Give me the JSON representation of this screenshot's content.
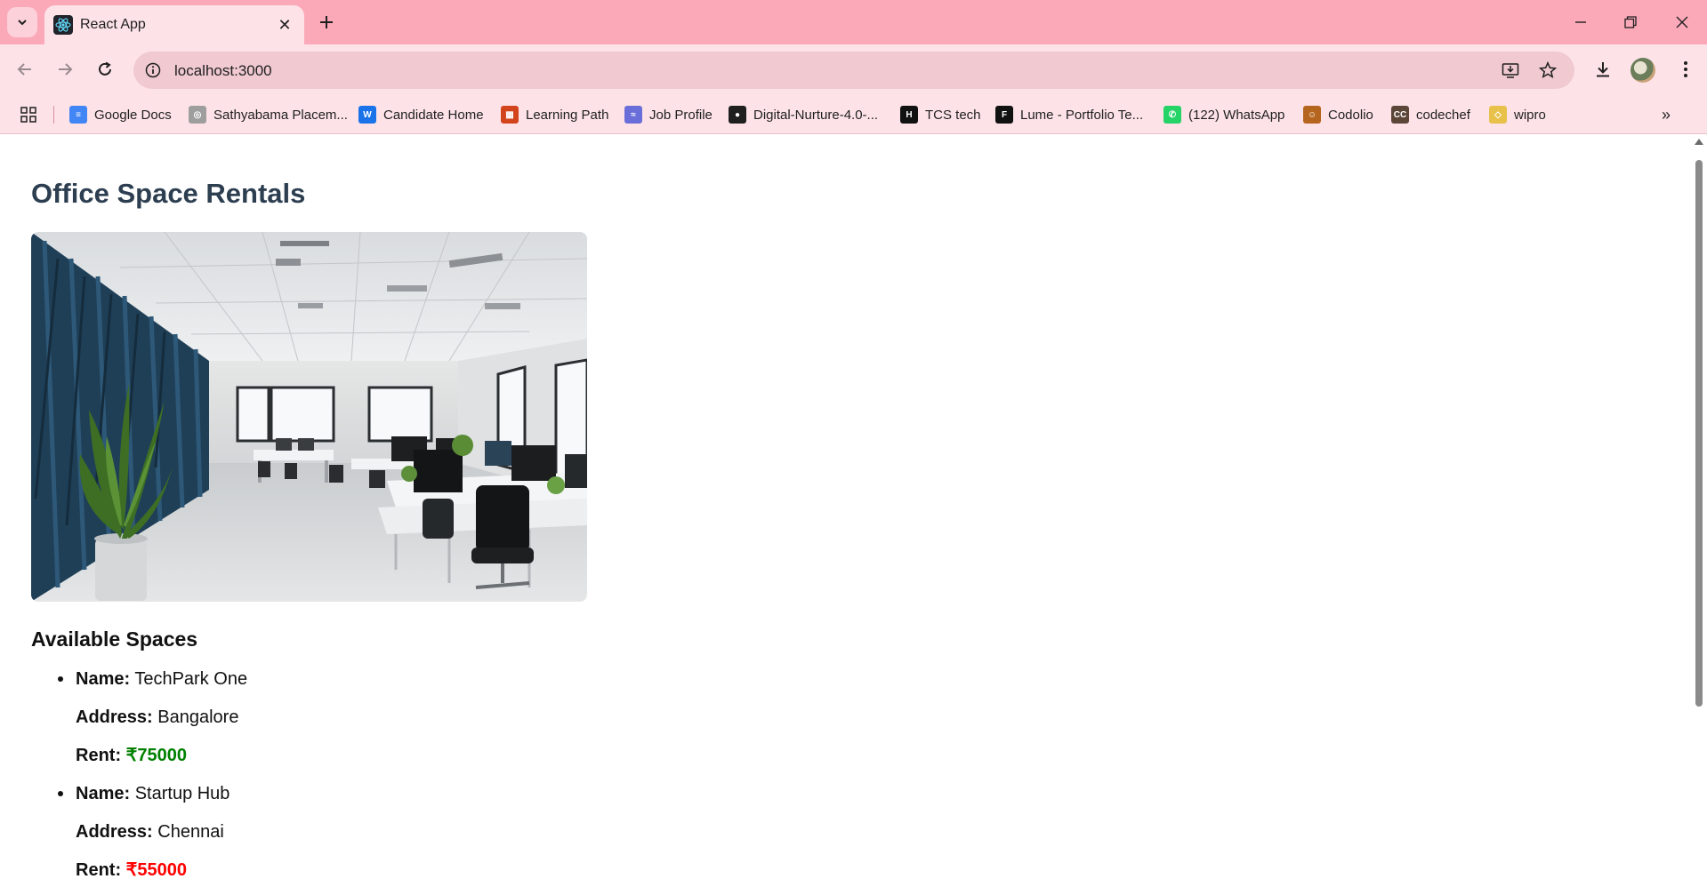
{
  "browser": {
    "tab_title": "React App",
    "url": "localhost:3000",
    "bookmarks": [
      {
        "label": "Google Docs",
        "icon": "google-docs-icon",
        "color": "#4285f4"
      },
      {
        "label": "Sathyabama Placem...",
        "icon": "sathyabama-icon",
        "color": "#9e9e9e"
      },
      {
        "label": "Candidate Home",
        "icon": "candidate-icon",
        "color": "#1a73e8"
      },
      {
        "label": "Learning Path",
        "icon": "learning-path-icon",
        "color": "#d2441c"
      },
      {
        "label": "Job Profile",
        "icon": "job-profile-icon",
        "color": "#6a6ed8"
      },
      {
        "label": "Digital-Nurture-4.0-...",
        "icon": "github-icon",
        "color": "#1f1f1f"
      },
      {
        "label": "TCS tech",
        "icon": "tcs-icon",
        "color": "#111111"
      },
      {
        "label": "Lume - Portfolio Te...",
        "icon": "framer-icon",
        "color": "#111111"
      },
      {
        "label": "(122) WhatsApp",
        "icon": "whatsapp-icon",
        "color": "#25d366"
      },
      {
        "label": "Codolio",
        "icon": "codolio-icon",
        "color": "#b5651d"
      },
      {
        "label": "codechef",
        "icon": "codechef-icon",
        "color": "#5b4638"
      },
      {
        "label": "wipro",
        "icon": "wipro-icon",
        "color": "#e8c14a"
      }
    ]
  },
  "page": {
    "title": "Office Space Rentals",
    "image_alt": "office-interior-photo",
    "section_heading": "Available Spaces",
    "labels": {
      "name": "Name:",
      "address": "Address:",
      "rent": "Rent:"
    },
    "spaces": [
      {
        "name": "TechPark One",
        "address": "Bangalore",
        "rent": "₹75000",
        "rent_color": "#008000"
      },
      {
        "name": "Startup Hub",
        "address": "Chennai",
        "rent": "₹55000",
        "rent_color": "#ff0000"
      }
    ]
  }
}
